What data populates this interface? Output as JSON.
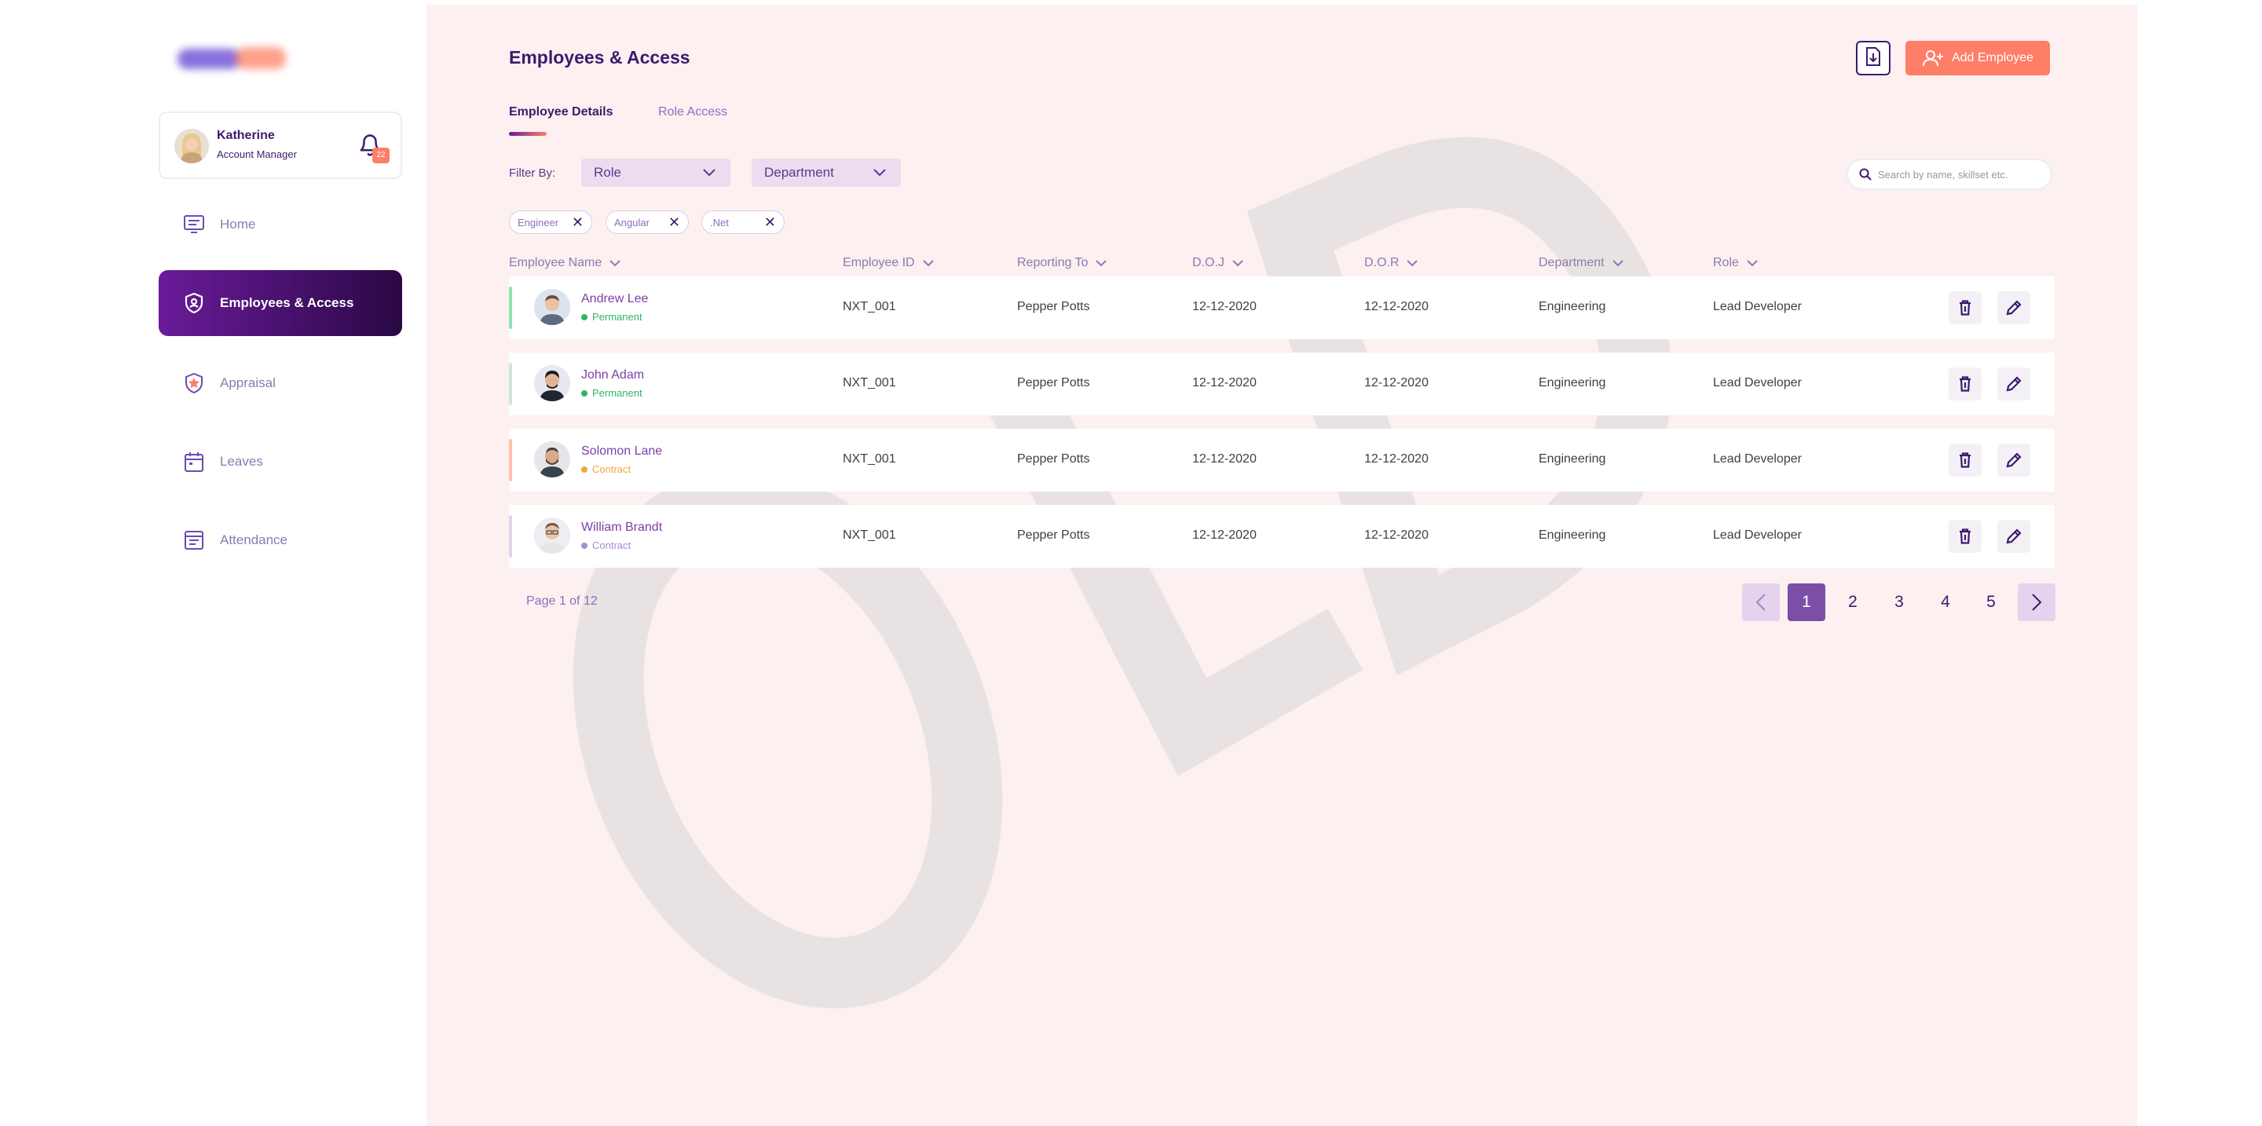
{
  "sidebar": {
    "profile": {
      "name": "Katherine",
      "title": "Account Manager",
      "notification_count": "22"
    },
    "nav": [
      {
        "label": "Home",
        "icon": "home-icon",
        "active": false
      },
      {
        "label": "Employees & Access",
        "icon": "shield-icon",
        "active": true
      },
      {
        "label": "Appraisal",
        "icon": "badge-star-icon",
        "active": false
      },
      {
        "label": "Leaves",
        "icon": "calendar-icon",
        "active": false
      },
      {
        "label": "Attendance",
        "icon": "attendance-icon",
        "active": false
      }
    ]
  },
  "main": {
    "title": "Employees & Access",
    "export_icon": "export-file-icon",
    "add_button_label": "Add Employee",
    "tabs": [
      {
        "label": "Employee Details",
        "active": true
      },
      {
        "label": "Role Access",
        "active": false
      }
    ],
    "filter_label": "Filter By:",
    "filters": [
      {
        "label": "Role"
      },
      {
        "label": "Department"
      }
    ],
    "search_placeholder": "Search by name, skillset etc.",
    "chips": [
      "Engineer",
      "Angular",
      ".Net"
    ],
    "columns": [
      "Employee Name",
      "Employee ID",
      "Reporting To",
      "D.O.J",
      "D.O.R",
      "Department",
      "Role"
    ],
    "rows": [
      {
        "name": "Andrew Lee",
        "status": "Permanent",
        "id": "NXT_001",
        "reporting_to": "Pepper Potts",
        "doj": "12-12-2020",
        "dor": "12-12-2020",
        "department": "Engineering",
        "role": "Lead Developer"
      },
      {
        "name": "John Adam",
        "status": "Permanent",
        "id": "NXT_001",
        "reporting_to": "Pepper Potts",
        "doj": "12-12-2020",
        "dor": "12-12-2020",
        "department": "Engineering",
        "role": "Lead Developer"
      },
      {
        "name": "Solomon Lane",
        "status": "Contract",
        "id": "NXT_001",
        "reporting_to": "Pepper Potts",
        "doj": "12-12-2020",
        "dor": "12-12-2020",
        "department": "Engineering",
        "role": "Lead Developer"
      },
      {
        "name": "William Brandt",
        "status": "Contract",
        "id": "NXT_001",
        "reporting_to": "Pepper Potts",
        "doj": "12-12-2020",
        "dor": "12-12-2020",
        "department": "Engineering",
        "role": "Lead Developer"
      }
    ],
    "pagination": {
      "info": "Page 1 of 12",
      "pages": [
        "1",
        "2",
        "3",
        "4",
        "5"
      ],
      "current": "1"
    },
    "watermark": "OLD"
  },
  "colors": {
    "brand_dark": "#3d1a6e",
    "accent": "#ff7e67",
    "permanent": "#2fb36b",
    "contract": "#f0a640",
    "contract_alt": "#a88bd0",
    "main_bg": "#fcf0f1"
  }
}
